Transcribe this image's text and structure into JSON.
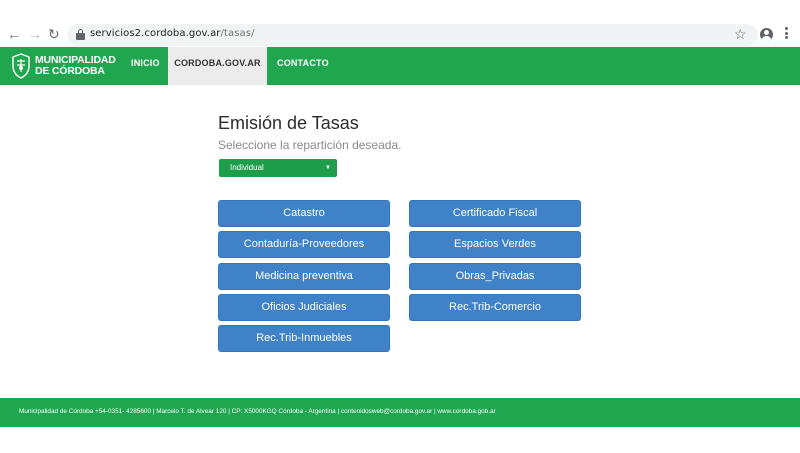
{
  "browser": {
    "url_host": "servicios2.cordoba.gov.ar",
    "url_path": "/tasas/",
    "icons": [
      "back-icon",
      "forward-icon",
      "reload-icon",
      "lock-icon",
      "star-icon",
      "profile-icon",
      "menu-icon"
    ]
  },
  "header": {
    "logo_line1": "MUNICIPALIDAD",
    "logo_line2": "DE CÓRDOBA",
    "nav": {
      "inicio": "INICIO",
      "cordoba": "CORDOBA.GOV.AR",
      "contacto": "CONTACTO"
    },
    "colors": {
      "brand_green": "#1fa64e",
      "active_tab_bg": "#ececec"
    }
  },
  "main": {
    "title": "Emisión de Tasas",
    "subtitle": "Seleccione la repartición deseada.",
    "select_value": "Individual",
    "buttons": [
      "Catastro",
      "Certificado Fiscal",
      "Contaduría-Proveedores",
      "Espacios Verdes",
      "Medicina preventiva",
      "Obras_Privadas",
      "Oficios Judiciales",
      "Rec.Trib-Comercio",
      "Rec.Trib-Inmuebles"
    ],
    "colors": {
      "button_blue": "#3f82c8",
      "select_green": "#1e9e4a"
    }
  },
  "footer": {
    "text": "Municipalidad de Córdoba +54-0351- 4285600 | Marcelo T. de Alvear 120 | CP: X5000KGQ Córdoba - Argentina | contenidosweb@cordoba.gov.ar | www.cordoba.gob.ar"
  }
}
